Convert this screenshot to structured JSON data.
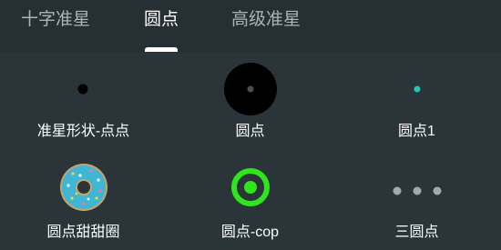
{
  "tabs": [
    {
      "label": "十字准星",
      "active": false
    },
    {
      "label": "圆点",
      "active": true
    },
    {
      "label": "高级准星",
      "active": false
    }
  ],
  "items": [
    {
      "label": "准星形状-点点",
      "icon": "small-dot-icon"
    },
    {
      "label": "圆点",
      "icon": "large-black-dot-icon"
    },
    {
      "label": "圆点1",
      "icon": "teal-dot-icon"
    },
    {
      "label": "圆点甜甜圈",
      "icon": "donut-icon"
    },
    {
      "label": "圆点-cop",
      "icon": "green-ring-icon"
    },
    {
      "label": "三圆点",
      "icon": "three-dots-icon"
    }
  ],
  "colors": {
    "background": "#2b3539",
    "tabbar": "#263034",
    "tab_inactive": "#a9b4b8",
    "teal_dot": "#1dc8b5",
    "green_ring": "#2ee619",
    "donut": "#3fb6d4",
    "three_dots": "#a3a8ab"
  }
}
